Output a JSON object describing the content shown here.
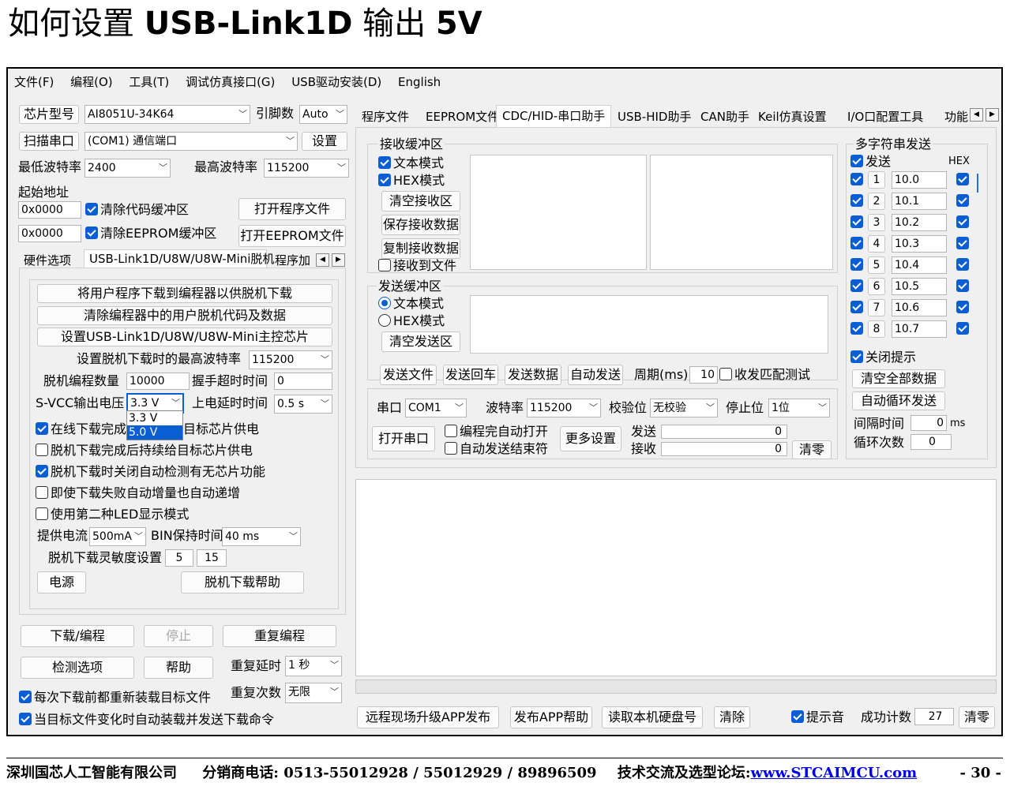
{
  "doc_title": {
    "prefix": "如何设置 ",
    "bold": "USB-Link1D",
    "middle": " 输出 ",
    "bold2": "5V"
  },
  "menu": [
    "文件(F)",
    "编程(O)",
    "工具(T)",
    "调试仿真接口(G)",
    "USB驱动安装(D)",
    "English"
  ],
  "left": {
    "chip_label": "芯片型号",
    "chip_value": "AI8051U-34K64",
    "pin_label": "引脚数",
    "pin_value": "Auto",
    "scan_port": "扫描串口",
    "port_value": "(COM1) 通信端口",
    "settings": "设置",
    "min_baud_label": "最低波特率",
    "min_baud": "2400",
    "max_baud_label": "最高波特率",
    "max_baud": "115200",
    "start_addr_label": "起始地址",
    "addr1": "0x0000",
    "clear_code": "清除代码缓冲区",
    "open_prog": "打开程序文件",
    "addr2": "0x0000",
    "clear_eeprom": "清除EEPROM缓冲区",
    "open_eeprom": "打开EEPROM文件",
    "tabs": [
      "硬件选项",
      "USB-Link1D/U8W/U8W-Mini脱机",
      "程序加"
    ],
    "offline": {
      "btn1": "将用户程序下载到编程器以供脱机下载",
      "btn2": "清除编程器中的用户脱机代码及数据",
      "btn3": "设置USB-Link1D/U8W/U8W-Mini主控芯片",
      "max_baud_label": "设置脱机下载时的最高波特率",
      "max_baud": "115200",
      "count_label": "脱机编程数量",
      "count": "10000",
      "handshake_label": "握手超时时间",
      "handshake": "0",
      "svcc_label": "S-VCC输出电压",
      "svcc": "3.3 V",
      "delay_label": "上电延时时间",
      "delay": "0.5 s",
      "dropdown": [
        "3.3 V",
        "5.0 V"
      ],
      "chk1a": "在线下载完成",
      "chk1b": "目标芯片供电",
      "chk2": "脱机下载完成后持续给目标芯片供电",
      "chk3": "脱机下载时关闭自动检测有无芯片功能",
      "chk4": "即使下载失败自动增量也自动递增",
      "chk5": "使用第二种LED显示模式",
      "current_label": "提供电流",
      "current": "500mA",
      "bin_label": "BIN保持时间",
      "bin": "40 ms",
      "sens_label": "脱机下载灵敏度设置",
      "sens1": "5",
      "sens2": "15",
      "power": "电源",
      "help": "脱机下载帮助"
    },
    "download": "下载/编程",
    "stop": "停止",
    "repeat": "重复编程",
    "check_opts": "检测选项",
    "help": "帮助",
    "repeat_delay_label": "重复延时",
    "repeat_delay": "1 秒",
    "repeat_count_label": "重复次数",
    "repeat_count": "无限",
    "reload1": "每次下载前都重新装载目标文件",
    "reload2": "当目标文件变化时自动装载并发送下载命令"
  },
  "right": {
    "tabs": [
      "程序文件",
      "EEPROM文件",
      "CDC/HID-串口助手",
      "USB-HID助手",
      "CAN助手",
      "Keil仿真设置",
      "I/O口配置工具",
      "功能"
    ],
    "recv_group": "接收缓冲区",
    "text_mode": "文本模式",
    "hex_mode": "HEX模式",
    "clear_recv": "清空接收区",
    "save_recv": "保存接收数据",
    "copy_recv": "复制接收数据",
    "recv_to_file": "接收到文件",
    "send_group": "发送缓冲区",
    "clear_send": "清空发送区",
    "send_file": "发送文件",
    "send_cr": "发送回车",
    "send_data": "发送数据",
    "auto_send": "自动发送",
    "period_label": "周期(ms)",
    "period": "10",
    "match_test": "收发匹配测试",
    "port_label": "串口",
    "port": "COM1",
    "baud_label": "波特率",
    "baud": "115200",
    "parity_label": "校验位",
    "parity": "无校验",
    "stop_label": "停止位",
    "stop": "1位",
    "open_port": "打开串口",
    "auto_open": "编程完自动打开",
    "auto_end": "自动发送结束符",
    "more": "更多设置",
    "tx_label": "发送",
    "tx": "0",
    "rx_label": "接收",
    "rx": "0",
    "clear_counts": "清零",
    "multi_group": "多字符串发送",
    "send_chk": "发送",
    "hex_hdr": "HEX",
    "multi": [
      {
        "n": "1",
        "v": "10.0"
      },
      {
        "n": "2",
        "v": "10.1"
      },
      {
        "n": "3",
        "v": "10.2"
      },
      {
        "n": "4",
        "v": "10.3"
      },
      {
        "n": "5",
        "v": "10.4"
      },
      {
        "n": "6",
        "v": "10.5"
      },
      {
        "n": "7",
        "v": "10.6"
      },
      {
        "n": "8",
        "v": "10.7"
      }
    ],
    "close_tip": "关闭提示",
    "clear_all": "清空全部数据",
    "auto_loop": "自动循环发送",
    "interval_label": "间隔时间",
    "interval": "0",
    "interval_unit": "ms",
    "loop_label": "循环次数",
    "loop": "0",
    "remote": "远程现场升级APP发布",
    "publish_help": "发布APP帮助",
    "read_disk": "读取本机硬盘号",
    "clear": "清除",
    "tip_sound": "提示音",
    "success_label": "成功计数",
    "success": "27",
    "clear2": "清零"
  },
  "footer": {
    "company": "深圳国芯人工智能有限公司",
    "phone": "分销商电话: 0513-55012928 / 55012929 / 89896509",
    "forum": "技术交流及选型论坛:",
    "url": "www.STCAIMCU.com",
    "page": "- 30 -"
  }
}
